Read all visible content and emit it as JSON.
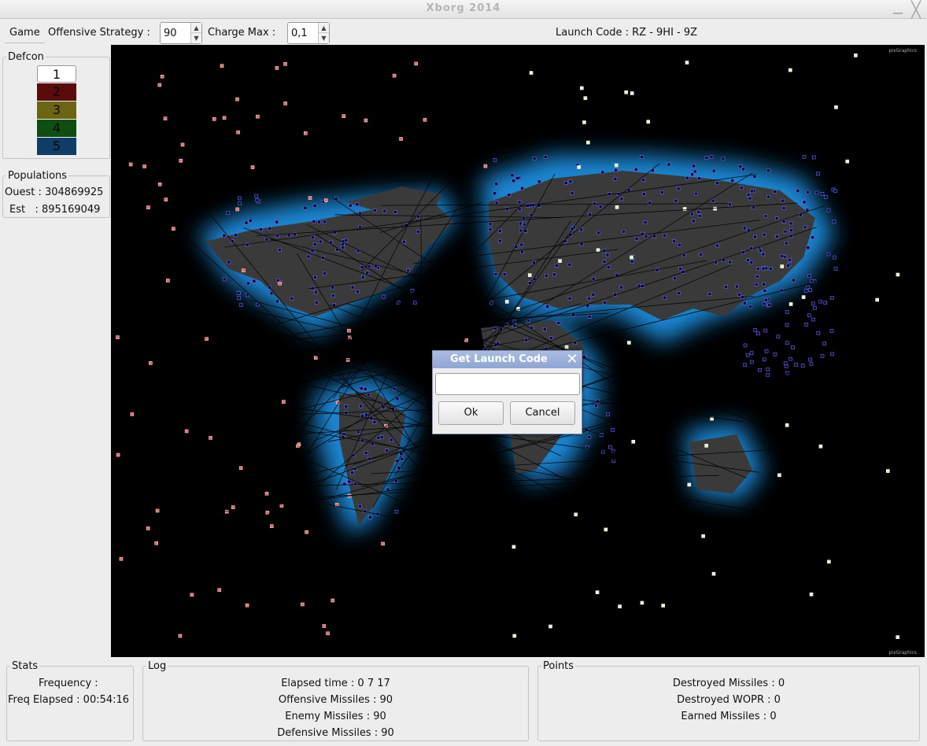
{
  "window": {
    "title": "Xborg 2014",
    "minimize_icon": "minimize-icon",
    "close_glyph": "╳"
  },
  "toolbar": {
    "menu_game": "Game",
    "offensive_label": "Offensive Strategy :",
    "offensive_value": "90",
    "charge_label": "Charge Max :",
    "charge_value": "0,1",
    "launch_code": "Launch Code : RZ - 9HI - 9Z"
  },
  "defcon": {
    "title": "Defcon",
    "levels": [
      {
        "label": "1",
        "color": "#ffffff"
      },
      {
        "label": "2",
        "color": "#5a0b0b"
      },
      {
        "label": "3",
        "color": "#6b6412"
      },
      {
        "label": "4",
        "color": "#0f4d14"
      },
      {
        "label": "5",
        "color": "#0f3d66"
      }
    ],
    "active": "1"
  },
  "populations": {
    "title": "Populations",
    "ouest": "Ouest : 304869925",
    "est": "Est   : 895169049"
  },
  "map": {
    "credit_top": "pixGraphics",
    "credit_bottom": "pixGraphics"
  },
  "dialog": {
    "title": "Get Launch Code",
    "input_value": "",
    "ok_label": "Ok",
    "cancel_label": "Cancel"
  },
  "stats": {
    "title": "Stats",
    "frequency": "Frequency :",
    "freq_elapsed": "Freq Elapsed : 00:54:16"
  },
  "log": {
    "title": "Log",
    "elapsed": "Elapsed time :  0 7 17",
    "offensive": "Offensive Missiles : 90",
    "enemy": "Enemy Missiles :  90",
    "defensive": "Defensive Missiles :  90"
  },
  "points": {
    "title": "Points",
    "destroyed_missiles": "Destroyed Missiles :  0",
    "destroyed_wopr": "Destroyed WOPR  :  0",
    "earned_missiles": "Earned Missiles :  0"
  },
  "colors": {
    "land": "#3a3a3a",
    "glow": "#1a8fe0",
    "player_sites": "#6a6aff",
    "enemy_sites": "#e06a6a",
    "neutral_sites": "#e8f0c8",
    "dialog_title": "#97aedb"
  }
}
